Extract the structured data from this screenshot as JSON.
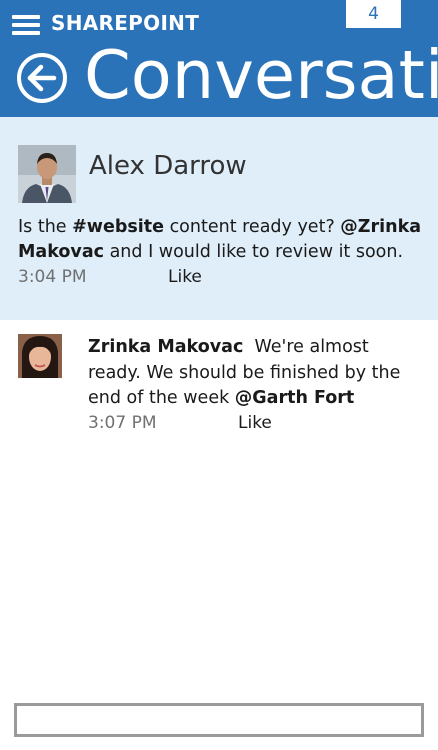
{
  "header": {
    "app_title": "SHAREPOINT",
    "badge_count": "4",
    "page_title": "Conversations",
    "menu_icon": "hamburger-menu-icon",
    "back_icon": "back-arrow-icon",
    "accent_color": "#2a73b9"
  },
  "post": {
    "author": "Alex Darrow",
    "body_part1": "Is the ",
    "hashtag": "#website",
    "body_part2": " content ready yet? ",
    "mention": "@Zrinka Makovac",
    "body_part3": " and I would like to review it soon.",
    "time": "3:04 PM",
    "like_label": "Like",
    "background_color": "#dfeef9"
  },
  "reply": {
    "author": "Zrinka Makovac",
    "body_part1": "We're almost ready. We should be finished by the end of the week ",
    "mention": "@Garth Fort",
    "time": "3:07 PM",
    "like_label": "Like"
  },
  "composer": {
    "placeholder": ""
  }
}
